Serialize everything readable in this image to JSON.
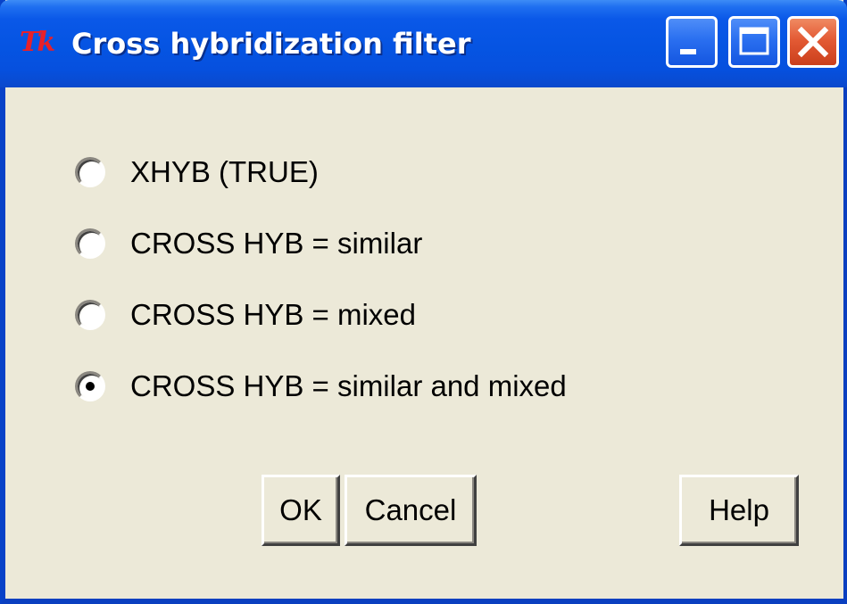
{
  "window": {
    "title": "Cross hybridization filter",
    "app_icon_text": "Tk",
    "controls": {
      "minimize": "minimize-icon",
      "maximize": "maximize-icon",
      "close": "close-icon"
    }
  },
  "options": [
    {
      "label": "XHYB (TRUE)",
      "selected": false
    },
    {
      "label": "CROSS HYB = similar",
      "selected": false
    },
    {
      "label": "CROSS HYB = mixed",
      "selected": false
    },
    {
      "label": "CROSS HYB = similar and mixed",
      "selected": true
    }
  ],
  "buttons": {
    "ok": "OK",
    "cancel": "Cancel",
    "help": "Help"
  },
  "colors": {
    "titlebar": "#0554e2",
    "face": "#ece9d8",
    "close": "#e35a34",
    "icon_red": "#e8202a"
  }
}
